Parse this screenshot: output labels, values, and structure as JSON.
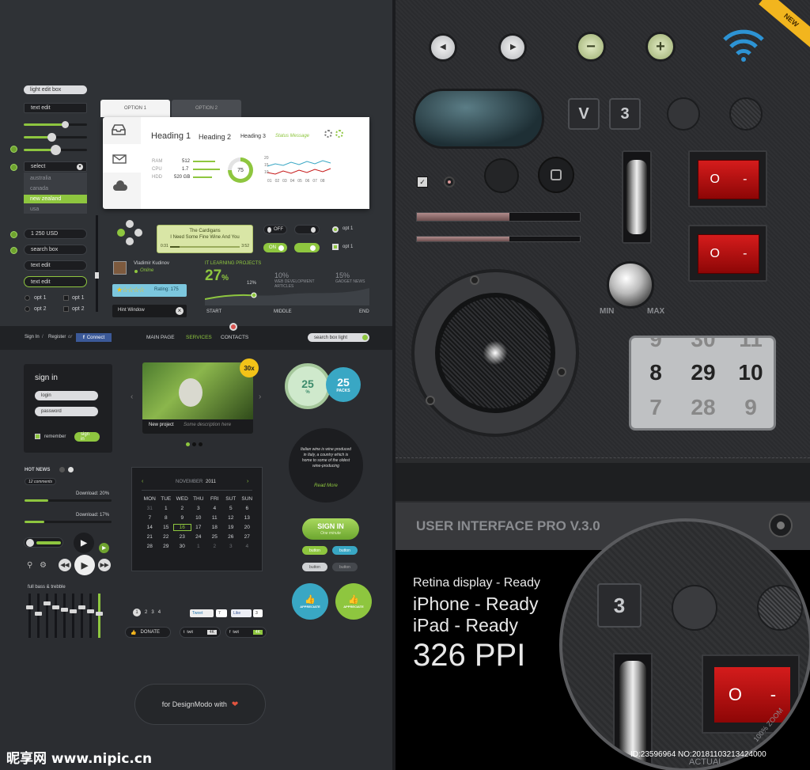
{
  "left": {
    "forms": {
      "light_edit_box": "light edit box",
      "text_edit": "text edit",
      "select": "select",
      "select_options": [
        "australia",
        "canada",
        "new zealand",
        "usa"
      ],
      "amount": "1 250 USD",
      "search_box": "search box",
      "text_edit_2": "text edit",
      "text_edit_3": "text edit",
      "opt1": "opt 1",
      "opt2": "opt 2"
    },
    "card": {
      "tab1": "OPTION 1",
      "tab2": "OPTION 2",
      "heading1": "Heading 1",
      "heading2": "Heading 2",
      "heading3": "Heading 3",
      "status": "Status Message",
      "rows": [
        {
          "label": "RAM",
          "value": "512"
        },
        {
          "label": "CPU",
          "value": "1.7"
        },
        {
          "label": "HDD",
          "value": "520 GB"
        }
      ],
      "donut": "75",
      "chart_x": [
        "01",
        "02",
        "03",
        "04",
        "05",
        "06",
        "07",
        "08"
      ],
      "chart_y": [
        "20",
        "15",
        "10"
      ]
    },
    "player": {
      "artist": "The Cardigans",
      "song": "I Need Some Fine Wine And You",
      "elapsed": "0:31",
      "total": "3:52"
    },
    "toggles": {
      "off": "OFF",
      "on": "ON",
      "opt1a": "opt 1",
      "opt1b": "opt 1"
    },
    "profile": {
      "name": "Vladimir Kudinov",
      "status": "Online",
      "rating": "Rating: 175",
      "hint": "Hint Window"
    },
    "progress": {
      "title": "IT LEARNING PROJECTS",
      "big": "27",
      "big_unit": "%",
      "mid": "10%",
      "mid_label": "WEB DEVELOPMENT ARTICLES",
      "right": "15%",
      "right_label": "GADGET NEWS",
      "marker": "12%",
      "start": "START",
      "middle": "MIDDLE",
      "end": "END"
    },
    "nav": {
      "sign_in": "Sign In",
      "slash": "/",
      "register": "Register",
      "or": "or",
      "connect": "Connect",
      "main_page": "MAIN PAGE",
      "services": "SERVICES",
      "contacts": "CONTACTS",
      "search_placeholder": "search box light"
    },
    "signin": {
      "title": "sign in",
      "login": "login",
      "password": "password",
      "remember": "remember",
      "button": "sign in"
    },
    "video": {
      "badge": "30x",
      "title": "New project",
      "desc": "Some description here"
    },
    "badges": {
      "b1": "25",
      "b1_sub": "%",
      "b2": "25",
      "b2_sub": "PACKS"
    },
    "quote": {
      "text": "Italian wine is wine produced in Italy, a country which is home to some of the oldest wine-producing",
      "more": "Read More"
    },
    "news": {
      "title": "HOT NEWS",
      "comments": "12 comments",
      "dl1": "Download: 20%",
      "dl2": "Download: 17%"
    },
    "calendar": {
      "month": "NOVEMBER",
      "year": "2011",
      "days": [
        "MON",
        "TUE",
        "WED",
        "THU",
        "FRI",
        "SUT",
        "SUN"
      ],
      "cells": [
        "31",
        "1",
        "2",
        "3",
        "4",
        "5",
        "6",
        "7",
        "8",
        "9",
        "10",
        "11",
        "12",
        "13",
        "14",
        "15",
        "16",
        "17",
        "18",
        "19",
        "20",
        "21",
        "22",
        "23",
        "24",
        "25",
        "26",
        "27",
        "28",
        "29",
        "30",
        "1",
        "2",
        "3",
        "4"
      ]
    },
    "buttons": {
      "signin_big": "SIGN IN",
      "signin_sub": "One minute",
      "button": "button",
      "appreciate": "APPRECIATE"
    },
    "eq": {
      "title": "full bass & trebble",
      "levels": [
        0.7,
        0.55,
        0.8,
        0.7,
        0.65,
        0.6,
        0.7,
        0.6,
        0.55
      ]
    },
    "social": {
      "pages": [
        "1",
        "2",
        "3",
        "4"
      ],
      "tweet": "Tweet",
      "tweet_count": "7",
      "like": "Like",
      "like_count": "3",
      "donate": "DONATE",
      "twit": "twit",
      "twit_count": "4K",
      "fb_twit": "twit",
      "fb_count": "4K"
    },
    "footer": "for DesignModo with"
  },
  "right": {
    "new_ribbon": "NEW",
    "v_key": "V",
    "three_key": "3",
    "rocker_on": "O",
    "rocker_off": "-",
    "bars": [
      0.57,
      0.57
    ],
    "min": "MIN",
    "max": "MAX",
    "counter": {
      "top": [
        "9",
        "30",
        "11"
      ],
      "mid": [
        "8",
        "29",
        "10"
      ],
      "bot": [
        "7",
        "28",
        "9"
      ]
    },
    "title": "USER INTERFACE PRO V.3.0"
  },
  "promo": {
    "line1": "Retina display - Ready",
    "line2": "iPhone - Ready",
    "line3": "iPad - Ready",
    "line4": "326 PPI",
    "zoom_key": "3",
    "zoom_rocker_on": "O",
    "zoom_rocker_off": "-",
    "zoom_label": "100% ZOOM",
    "actual": "ACTUAL"
  },
  "watermark": {
    "site": "昵享网 www.nipic.cn",
    "id": "ID:23596964 NO:20181103213424000"
  },
  "colors": {
    "accent": "#8ec63f",
    "teal": "#39a7c4",
    "red": "#c61818"
  }
}
